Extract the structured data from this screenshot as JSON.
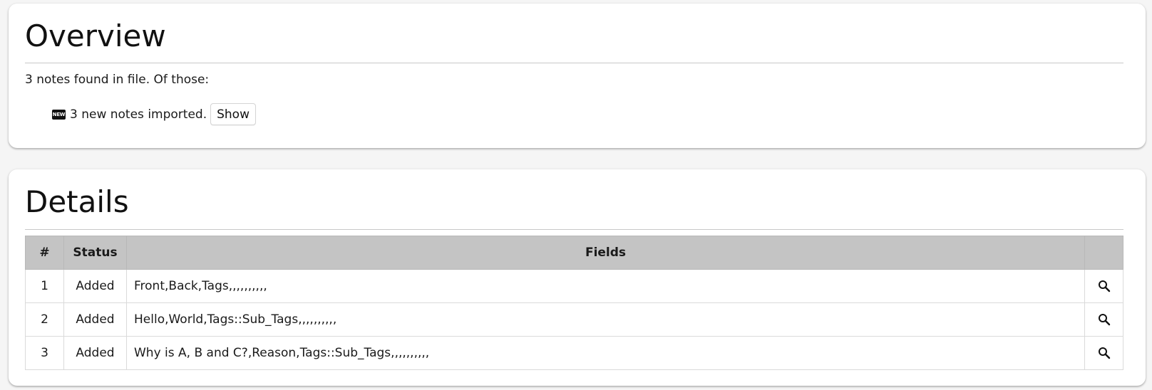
{
  "overview": {
    "title": "Overview",
    "summary": "3 notes found in file. Of those:",
    "import_icon": "new-badge-icon",
    "import_icon_text": "NEW",
    "import_text": "3 new notes imported.",
    "show_label": "Show"
  },
  "details": {
    "title": "Details",
    "columns": [
      "#",
      "Status",
      "Fields",
      ""
    ],
    "rows": [
      {
        "num": "1",
        "status": "Added",
        "fields": "Front,Back,Tags,,,,,,,,,,"
      },
      {
        "num": "2",
        "status": "Added",
        "fields": "Hello,World,Tags::Sub_Tags,,,,,,,,,,"
      },
      {
        "num": "3",
        "status": "Added",
        "fields": "Why is A, B and C?,Reason,Tags::Sub_Tags,,,,,,,,,,"
      }
    ],
    "row_action_icon": "search-icon"
  },
  "colors": {
    "background": "#f5f5f5",
    "card": "#ffffff",
    "table_header": "#c4c4c4"
  }
}
